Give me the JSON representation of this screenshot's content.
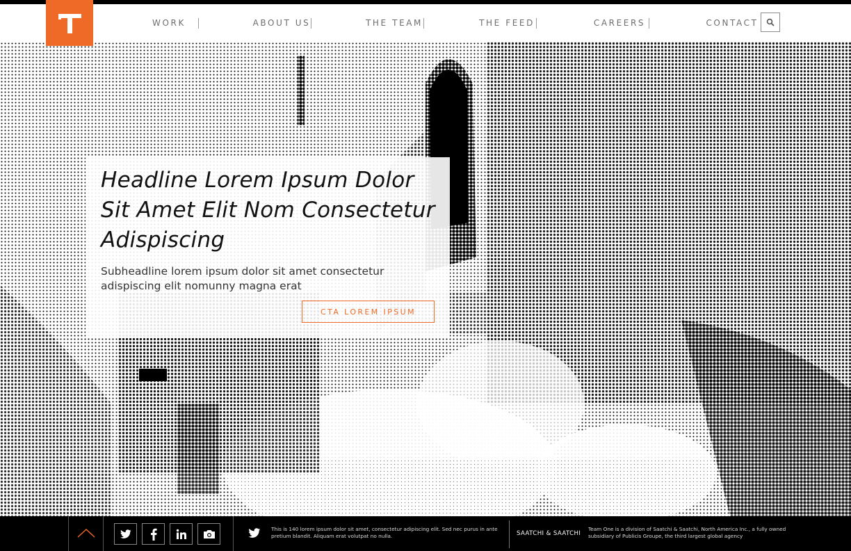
{
  "brand": {
    "logo_letter": "T",
    "accent_color": "#ef6a26"
  },
  "nav": {
    "items": [
      {
        "label": "WORK"
      },
      {
        "label": "ABOUT US"
      },
      {
        "label": "THE TEAM"
      },
      {
        "label": "THE FEED"
      },
      {
        "label": "CAREERS"
      },
      {
        "label": "CONTACT"
      }
    ],
    "search_icon": "search-icon"
  },
  "hero": {
    "image_description_icon": "space-shuttle-launch-halftone",
    "headline": "Headline Lorem Ipsum Dolor Sit Amet Elit Nom Consectetur Adispiscing",
    "subheadline": "Subheadline lorem ipsum dolor sit amet consectetur adispiscing elit nomunny magna erat",
    "cta_label": "CTA LOREM IPSUM"
  },
  "footer": {
    "back_to_top_icon": "chevron-up-icon",
    "social": [
      {
        "name": "twitter",
        "icon": "twitter-icon"
      },
      {
        "name": "facebook",
        "icon": "facebook-icon"
      },
      {
        "name": "linkedin",
        "icon": "linkedin-icon"
      },
      {
        "name": "instagram",
        "icon": "camera-icon"
      }
    ],
    "tweet_text": "This is 140 lorem ipsum dolor sit amet, consectetur adipiscing elit. Sed nec purus in ante pretium blandit. Aliquam erat volutpat no nulla.",
    "agency_name": "SAATCHI & SAATCHI",
    "legal_text": "Team One is a division of Saatchi & Saatchi, North America Inc., a fully owned subsidiary of Publicis Groupe, the third largest global agency"
  }
}
